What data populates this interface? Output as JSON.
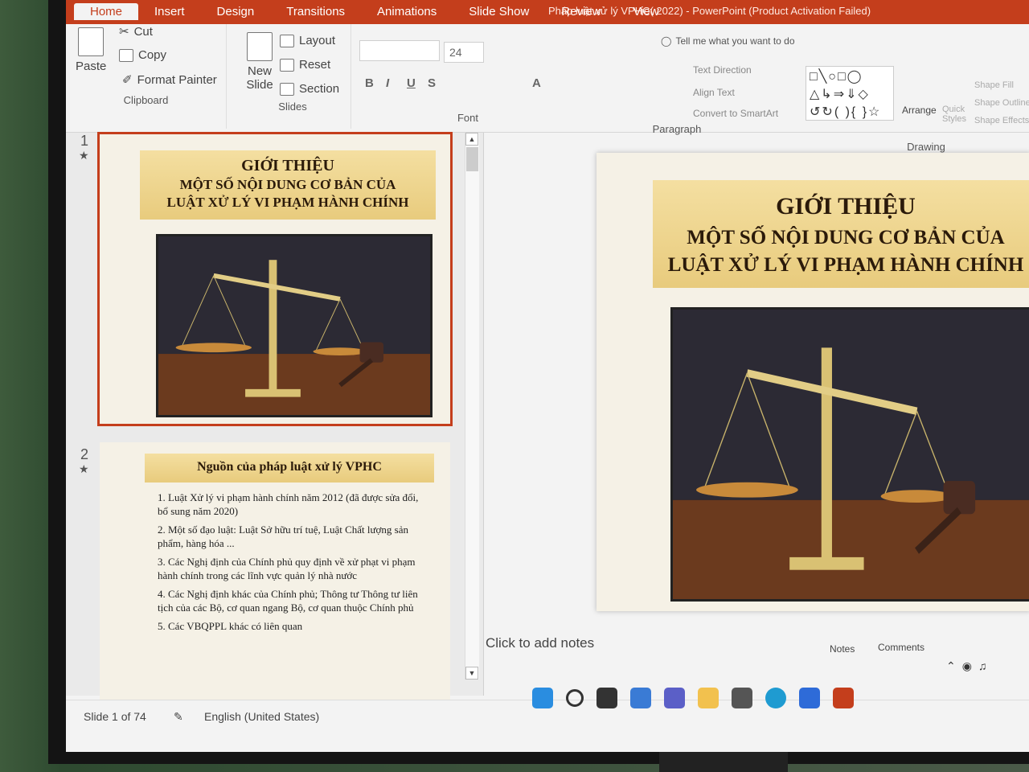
{
  "window": {
    "title": "Pháp luật xử lý VPHC( 2022) - PowerPoint (Product Activation Failed)"
  },
  "tabs": [
    "Home",
    "Insert",
    "Design",
    "Transitions",
    "Animations",
    "Slide Show",
    "Review",
    "View"
  ],
  "tell_me": "Tell me what you want to do",
  "ribbon": {
    "clipboard": {
      "paste": "Paste",
      "cut": "Cut",
      "copy": "Copy",
      "format_painter": "Format Painter",
      "label": "Clipboard"
    },
    "slides": {
      "new_slide": "New Slide",
      "layout": "Layout",
      "reset": "Reset",
      "section": "Section",
      "label": "Slides"
    },
    "font": {
      "size": "24",
      "label": "Font"
    },
    "paragraph": {
      "text_direction": "Text Direction",
      "align_text": "Align Text",
      "convert_smartart": "Convert to SmartArt",
      "label": "Paragraph"
    },
    "drawing": {
      "arrange": "Arrange",
      "quick_styles": "Quick Styles",
      "shape_fill": "Shape Fill",
      "shape_outline": "Shape Outline",
      "shape_effects": "Shape Effects",
      "label": "Drawing"
    }
  },
  "slides": [
    {
      "number": "1",
      "title_line1": "GIỚI THIỆU",
      "title_line2": "MỘT SỐ NỘI DUNG CƠ BẢN CỦA",
      "title_line3": "LUẬT XỬ LÝ VI PHẠM HÀNH CHÍNH"
    },
    {
      "number": "2",
      "title": "Nguồn của pháp luật xử lý VPHC",
      "items": [
        "1. Luật Xử lý vi phạm hành chính năm 2012 (đã được sửa đổi, bổ sung năm 2020)",
        "2. Một số đạo luật: Luật Sở hữu trí tuệ, Luật Chất lượng sản phẩm, hàng hóa ...",
        "3. Các Nghị định của Chính phủ quy định về xử phạt vi phạm hành chính trong các lĩnh vực quản lý nhà nước",
        "4. Các Nghị định khác của Chính phủ; Thông tư Thông tư liên tịch của các Bộ, cơ quan ngang Bộ, cơ quan thuộc Chính phủ",
        "5. Các VBQPPL khác có liên quan"
      ]
    }
  ],
  "notes_placeholder": "Click to add notes",
  "status": {
    "slide_counter": "Slide 1 of 74",
    "language": "English (United States)",
    "notes": "Notes",
    "comments": "Comments"
  },
  "colors": {
    "accent": "#c43e1c",
    "banner": "#f0d68f",
    "slide_bg": "#f5f1e6"
  }
}
